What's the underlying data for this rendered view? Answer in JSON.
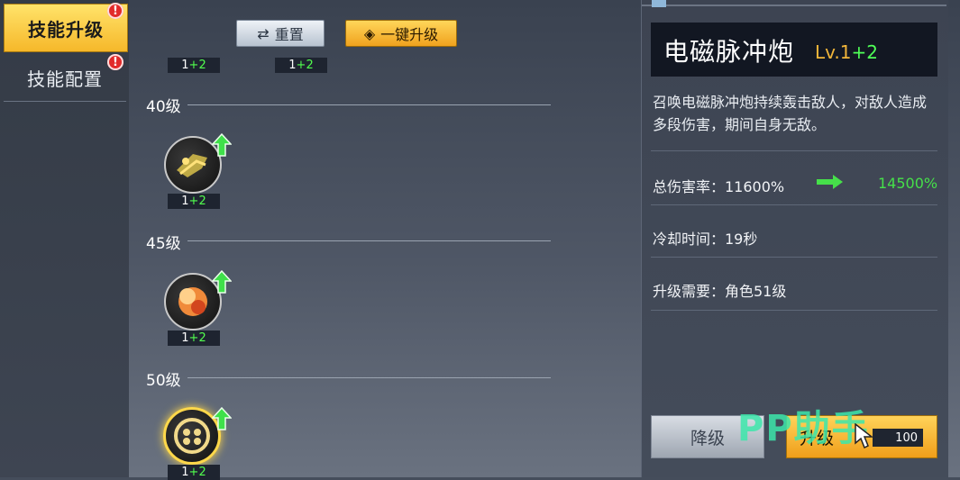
{
  "nav": {
    "tabs": [
      {
        "label": "技能升级",
        "active": true,
        "alert": "!"
      },
      {
        "label": "技能配置",
        "active": false,
        "alert": "!"
      }
    ]
  },
  "toolbar": {
    "reset_label": "重置",
    "upgrade_all_label": "一键升级",
    "badges": [
      {
        "base": "1",
        "bonus": "+2"
      },
      {
        "base": "1",
        "bonus": "+2"
      }
    ]
  },
  "tiers": [
    {
      "label": "40级",
      "skill": {
        "icon": "cannon-skill-icon",
        "base": "1",
        "bonus": "+2",
        "upgradable": true
      }
    },
    {
      "label": "45级",
      "skill": {
        "icon": "explosion-skill-icon",
        "base": "1",
        "bonus": "+2",
        "upgradable": true
      }
    },
    {
      "label": "50级",
      "skill": {
        "icon": "vortex-skill-icon",
        "base": "1",
        "bonus": "+2",
        "upgradable": true,
        "selected": true
      }
    }
  ],
  "detail": {
    "name": "电磁脉冲炮",
    "level_prefix": "Lv.1",
    "level_bonus": "+2",
    "description": "召唤电磁脉冲炮持续轰击敌人，对敌人造成多段伤害，期间自身无敌。",
    "damage_label": "总伤害率：11600%",
    "damage_next": "14500%",
    "cooldown_label": "冷却时间：19秒",
    "requirement_label": "升级需要：角色51级",
    "downgrade_label": "降级",
    "upgrade_label": "升级",
    "cost": "100"
  },
  "watermark": "PP助手",
  "colors": {
    "accent": "#f6b82a",
    "bonus_green": "#52ff4e",
    "alert_red": "#e22a2a"
  }
}
